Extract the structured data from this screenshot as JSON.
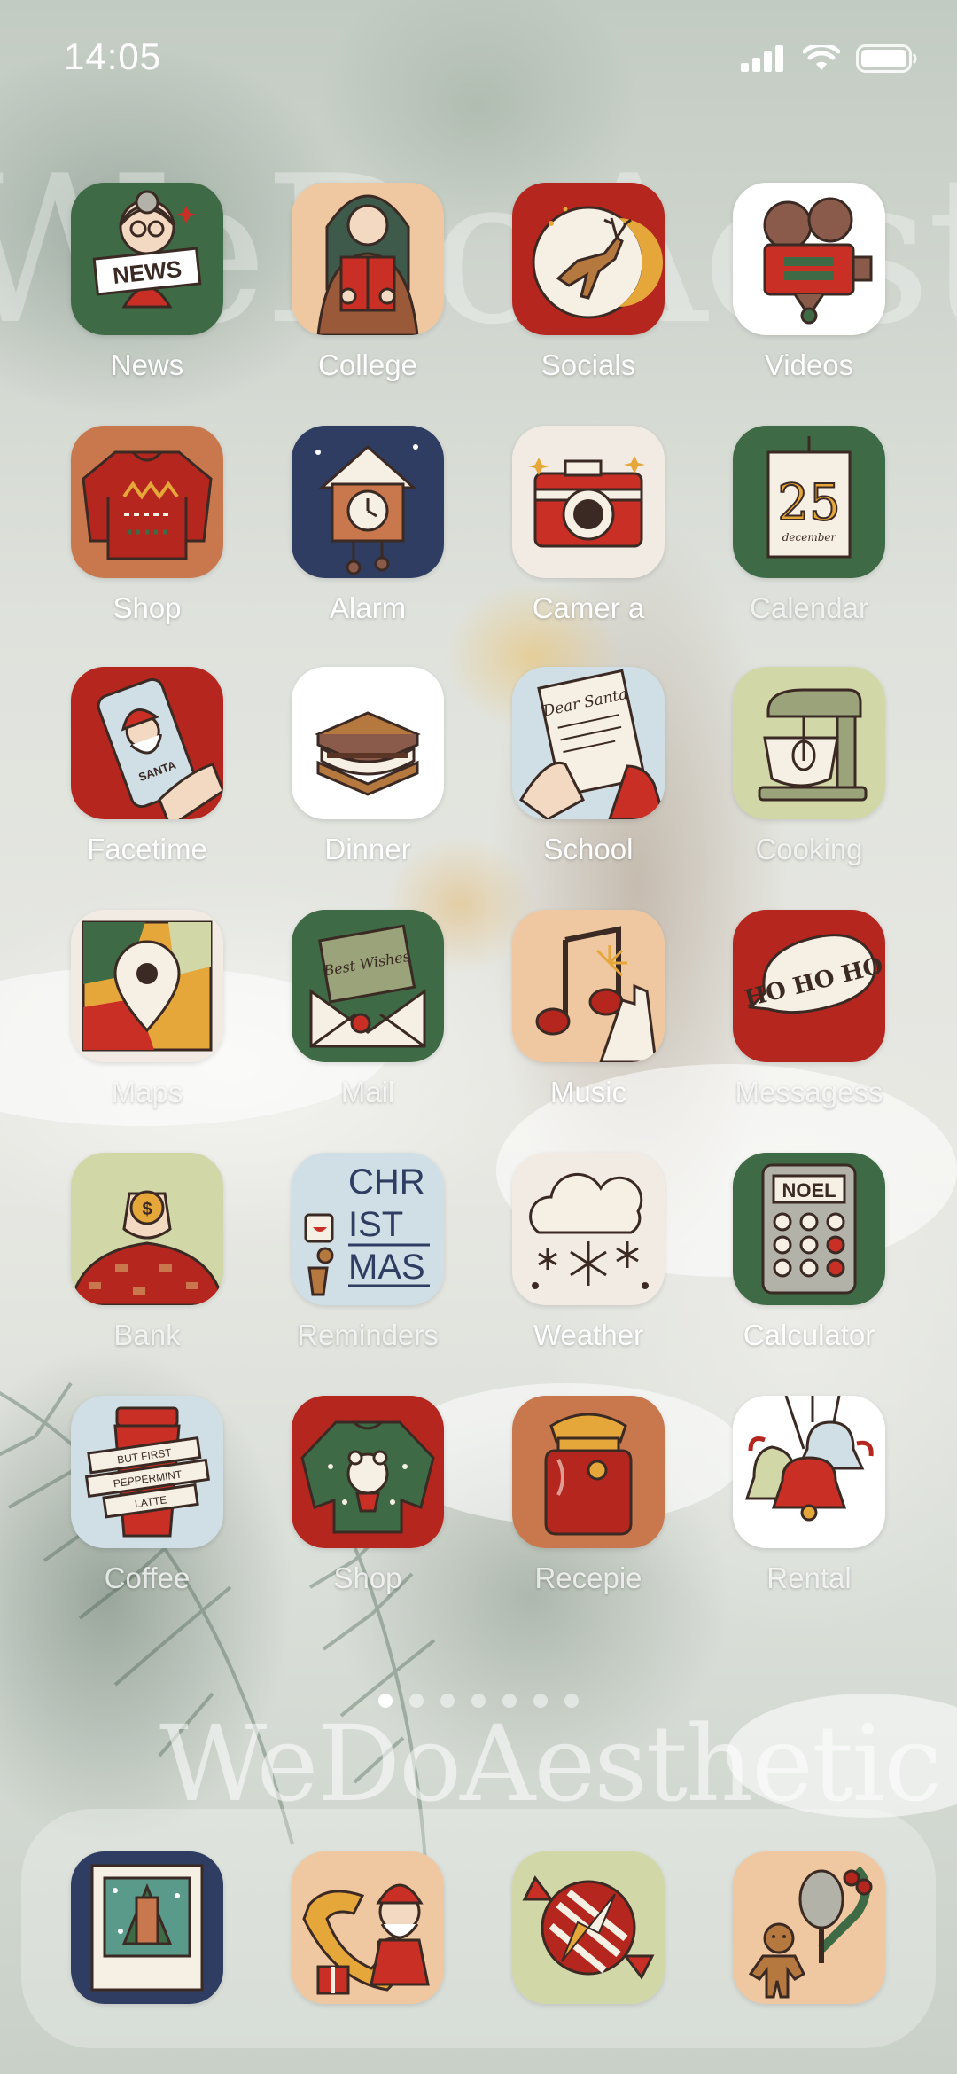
{
  "status_bar": {
    "time": "14:05",
    "icons": [
      "cellular-signal-icon",
      "wifi-icon",
      "battery-icon"
    ]
  },
  "watermark": {
    "top": "WeDoAesthetic",
    "bottom": "WeDoAesthetic"
  },
  "apps": [
    {
      "label": "News",
      "icon": "news-girl-icon",
      "bg": "#3e6b45"
    },
    {
      "label": "College",
      "icon": "reading-girl-icon",
      "bg": "#efc7a0"
    },
    {
      "label": "Socials",
      "icon": "reindeer-moon-icon",
      "bg": "#b5261e"
    },
    {
      "label": "Videos",
      "icon": "film-camera-icon",
      "bg": "#ffffff"
    },
    {
      "label": "Shop",
      "icon": "christmas-sweater-icon",
      "bg": "#c9784d"
    },
    {
      "label": "Alarm",
      "icon": "cuckoo-clock-icon",
      "bg": "#2f3d62"
    },
    {
      "label": "Camer a",
      "icon": "camera-icon",
      "bg": "#f2ebe4"
    },
    {
      "label": "Calendar",
      "icon": "calendar-25-icon",
      "bg": "#3e6b45"
    },
    {
      "label": "Facetime",
      "icon": "santa-phone-icon",
      "bg": "#b5261e"
    },
    {
      "label": "Dinner",
      "icon": "smores-icon",
      "bg": "#ffffff"
    },
    {
      "label": "School",
      "icon": "dear-santa-letter-icon",
      "bg": "#cfdfe5"
    },
    {
      "label": "Cooking",
      "icon": "stand-mixer-icon",
      "bg": "#d2d7a8"
    },
    {
      "label": "Maps",
      "icon": "map-pin-icon",
      "bg": "#f2ebe4"
    },
    {
      "label": "Mail",
      "icon": "best-wishes-envelope-icon",
      "bg": "#3e6b45"
    },
    {
      "label": "Music",
      "icon": "music-note-sparkler-icon",
      "bg": "#efc7a0"
    },
    {
      "label": "Messagess",
      "icon": "ho-ho-ho-bubble-icon",
      "bg": "#b5261e"
    },
    {
      "label": "Bank",
      "icon": "coin-sweater-icon",
      "bg": "#d2d7a8"
    },
    {
      "label": "Reminders",
      "icon": "christmas-text-icon",
      "bg": "#cfdfe5"
    },
    {
      "label": "Weather",
      "icon": "snow-cloud-icon",
      "bg": "#f2ebe4"
    },
    {
      "label": "Calculator",
      "icon": "noel-calculator-icon",
      "bg": "#3e6b45"
    },
    {
      "label": "Coffee",
      "icon": "peppermint-latte-icon",
      "bg": "#cfdfe5"
    },
    {
      "label": "Shop",
      "icon": "polar-bear-sweater-icon",
      "bg": "#b5261e"
    },
    {
      "label": "Recepie",
      "icon": "jam-jar-icon",
      "bg": "#c9784d"
    },
    {
      "label": "Rental",
      "icon": "christmas-bells-icon",
      "bg": "#ffffff"
    }
  ],
  "coffee_text": [
    "BUT FIRST",
    "PEPPERMINT",
    "LATTE"
  ],
  "reminders_text": [
    "CHR",
    "IST",
    "MAS"
  ],
  "calendar_text": {
    "day": "25",
    "month": "december"
  },
  "calculator_text": "NOEL",
  "news_text": "NEWS",
  "messages_text": "HO HO HO",
  "mail_text": "Best Wishes",
  "school_text": "Dear Santa",
  "facetime_text": "SANTA",
  "page_dots": {
    "count": 7,
    "active": 0
  },
  "dock": [
    {
      "icon": "polaroid-photo-icon",
      "bg": "#2f3d62"
    },
    {
      "icon": "santa-telephone-icon",
      "bg": "#efc7a0"
    },
    {
      "icon": "peppermint-compass-icon",
      "bg": "#d2d7a8"
    },
    {
      "icon": "gingerbread-microphone-icon",
      "bg": "#efc7a0"
    }
  ]
}
